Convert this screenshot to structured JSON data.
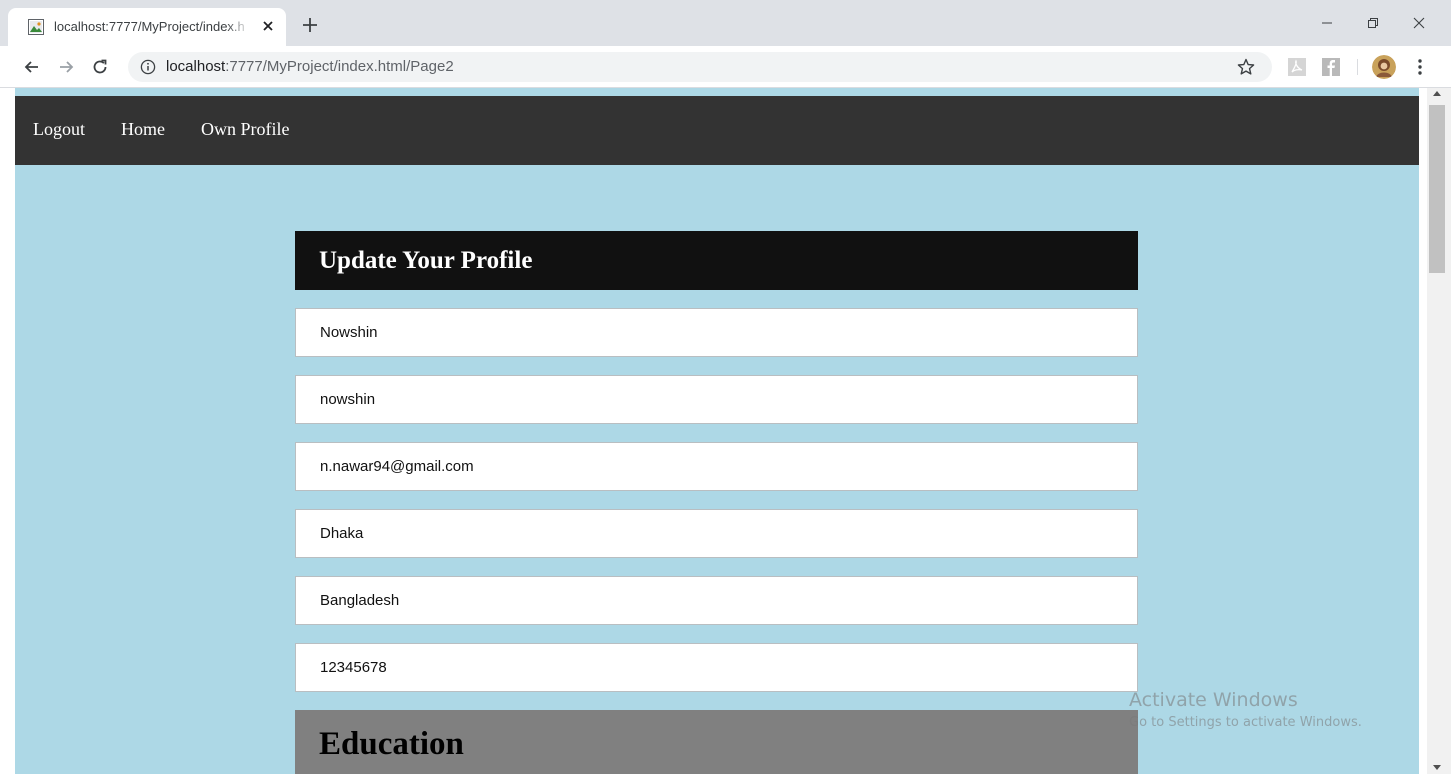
{
  "browser": {
    "tab_title": "localhost:7777/MyProject/index.h",
    "url_host": "localhost",
    "url_rest": ":7777/MyProject/index.html/Page2"
  },
  "navbar": {
    "links": [
      "Logout",
      "Home",
      "Own Profile"
    ]
  },
  "form": {
    "title": "Update Your Profile",
    "fields": [
      {
        "name": "name",
        "value": "Nowshin"
      },
      {
        "name": "username",
        "value": "nowshin"
      },
      {
        "name": "email",
        "value": "n.nawar94@gmail.com"
      },
      {
        "name": "city",
        "value": "Dhaka"
      },
      {
        "name": "country",
        "value": "Bangladesh"
      },
      {
        "name": "phone",
        "value": "12345678"
      }
    ],
    "education_title": "Education"
  },
  "watermark": {
    "title": "Activate Windows",
    "subtitle": "Go to Settings to activate Windows."
  },
  "colors": {
    "page_background": "#add8e6",
    "navbar": "#333333",
    "form_header": "#111111",
    "education_header": "#808080"
  },
  "icons": [
    "page-favicon-icon",
    "close-icon",
    "plus-icon",
    "minimize-icon",
    "restore-icon",
    "window-close-icon",
    "back-arrow-icon",
    "forward-arrow-icon",
    "reload-icon",
    "info-icon",
    "star-icon",
    "pdf-extension-icon",
    "facebook-extension-icon",
    "avatar",
    "menu-dots-icon"
  ]
}
